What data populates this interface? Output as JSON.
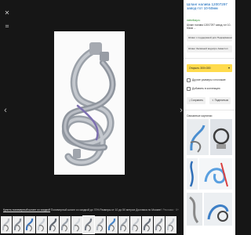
{
  "viewer": {
    "caption_link": "Купить полимерный шланг со скидкой",
    "caption_rest": " Полимерный шланг со скидкой до 70% Размеры от 10 до 50 метров Доставка по Москве!",
    "caption_meta": "Реклама · 0+",
    "nav_prev": "‹",
    "nav_next": "›"
  },
  "panel": {
    "title": "Шланг налива 12007297 завод-тот 10-50мм",
    "domain": "mebelbay.ru",
    "description": "Шланг налива 12007297 завод-тот 10-50мм ...",
    "chips": [
      "Шланг с поддержкой для Подкарманного ...",
      "Шланг Заливной водопро Аквастоп"
    ],
    "open_button": "Открыть 300×300",
    "actions": [
      "Другие размеры и похожие",
      "Добавить в коллекцию"
    ],
    "save": "Сохранить",
    "share": "Поделиться",
    "similar_header": "Связанные картинки"
  },
  "colors": {
    "accent_yellow": "#ffdb4d",
    "link_blue": "#0b63b8",
    "domain_green": "#2b8a2b",
    "background_dark": "#161616"
  },
  "icons": [
    "close-icon",
    "crop-icon",
    "chevron-left-icon",
    "chevron-right-icon",
    "collection-icon",
    "share-icon",
    "save-icon"
  ]
}
